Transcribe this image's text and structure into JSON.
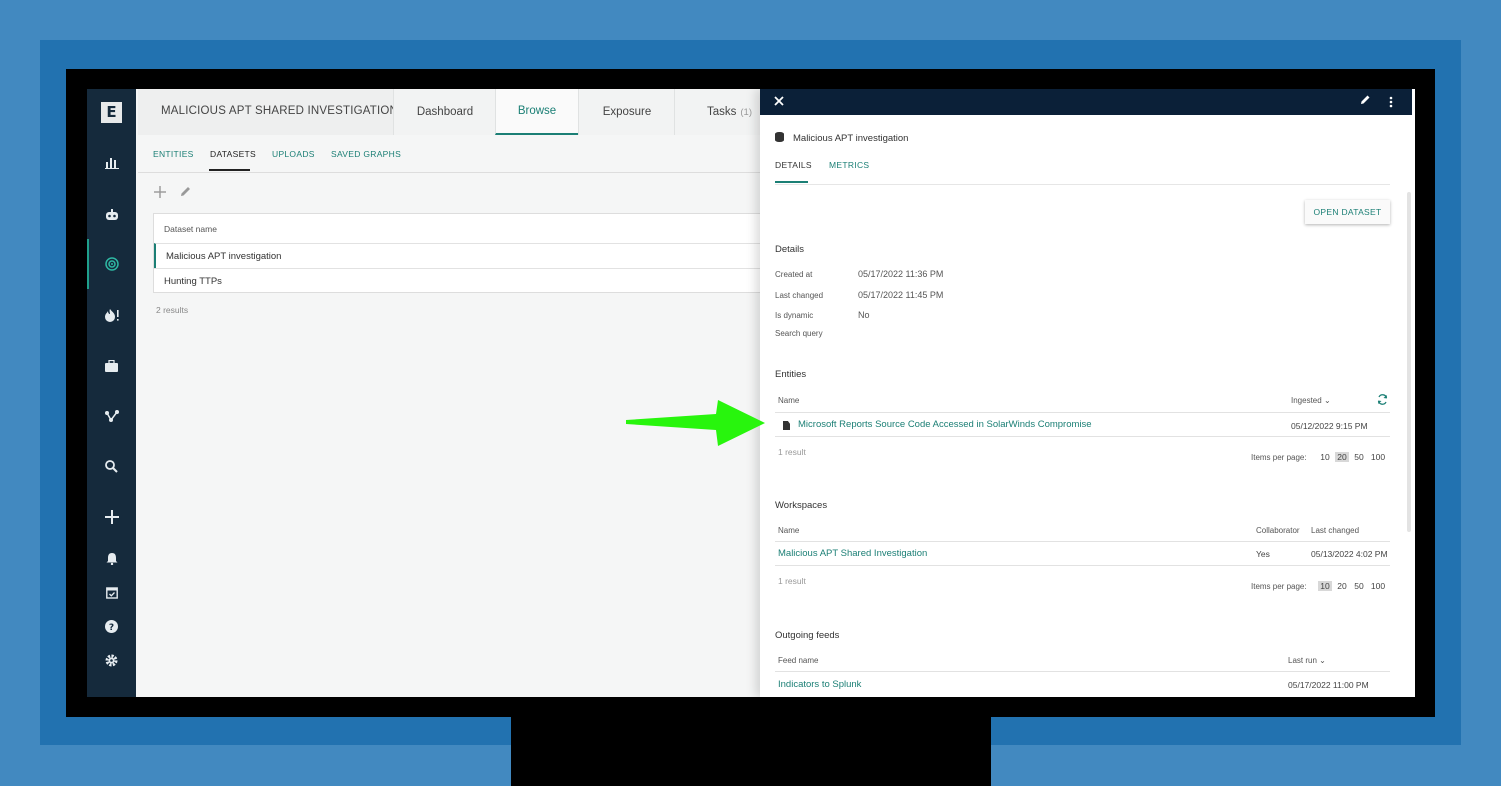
{
  "colors": {
    "accent": "#1b7f75",
    "sidebar": "#152a3c",
    "panel_header": "#0b2038",
    "arrow": "#28f50d"
  },
  "sidebar": {
    "logo": "E",
    "icons": [
      "bar-chart-icon",
      "robot-icon",
      "target-icon",
      "fire-alert-icon",
      "briefcase-icon",
      "graph-icon",
      "search-icon",
      "plus-icon",
      "bell-icon",
      "calendar-check-icon",
      "help-icon",
      "gear-icon"
    ]
  },
  "header": {
    "title": "MALICIOUS APT SHARED INVESTIGATION",
    "tabs": [
      {
        "label": "Dashboard"
      },
      {
        "label": "Browse"
      },
      {
        "label": "Exposure"
      },
      {
        "label": "Tasks",
        "count": "(1)"
      }
    ]
  },
  "subtabs": [
    "ENTITIES",
    "DATASETS",
    "UPLOADS",
    "SAVED GRAPHS"
  ],
  "datasets": {
    "column": "Dataset name",
    "rows": [
      "Malicious APT investigation",
      "Hunting TTPs"
    ],
    "results": "2 results"
  },
  "panel": {
    "title": "Malicious APT investigation",
    "tabs": [
      "DETAILS",
      "METRICS"
    ],
    "open_button": "OPEN DATASET",
    "details": {
      "title": "Details",
      "fields": [
        {
          "k": "Created at",
          "v": "05/17/2022 11:36 PM"
        },
        {
          "k": "Last changed",
          "v": "05/17/2022 11:45 PM"
        },
        {
          "k": "Is dynamic",
          "v": "No"
        },
        {
          "k": "Search query",
          "v": ""
        }
      ]
    },
    "entities": {
      "title": "Entities",
      "col_name": "Name",
      "col_ingested": "Ingested",
      "row_name": "Microsoft Reports Source Code Accessed in SolarWinds Compromise",
      "row_date": "05/12/2022 9:15 PM",
      "results": "1 result",
      "items_per_page": "Items per page:",
      "pages": [
        "10",
        "20",
        "50",
        "100"
      ]
    },
    "workspaces": {
      "title": "Workspaces",
      "col_name": "Name",
      "col_collab": "Collaborator",
      "col_changed": "Last changed",
      "row_name": "Malicious APT Shared Investigation",
      "row_collab": "Yes",
      "row_changed": "05/13/2022 4:02 PM",
      "results": "1 result",
      "items_per_page": "Items per page:",
      "pages": [
        "10",
        "20",
        "50",
        "100"
      ]
    },
    "feeds": {
      "title": "Outgoing feeds",
      "col_name": "Feed name",
      "col_lastrun": "Last run",
      "row_name": "Indicators to Splunk",
      "row_lastrun": "05/17/2022 11:00 PM"
    }
  }
}
